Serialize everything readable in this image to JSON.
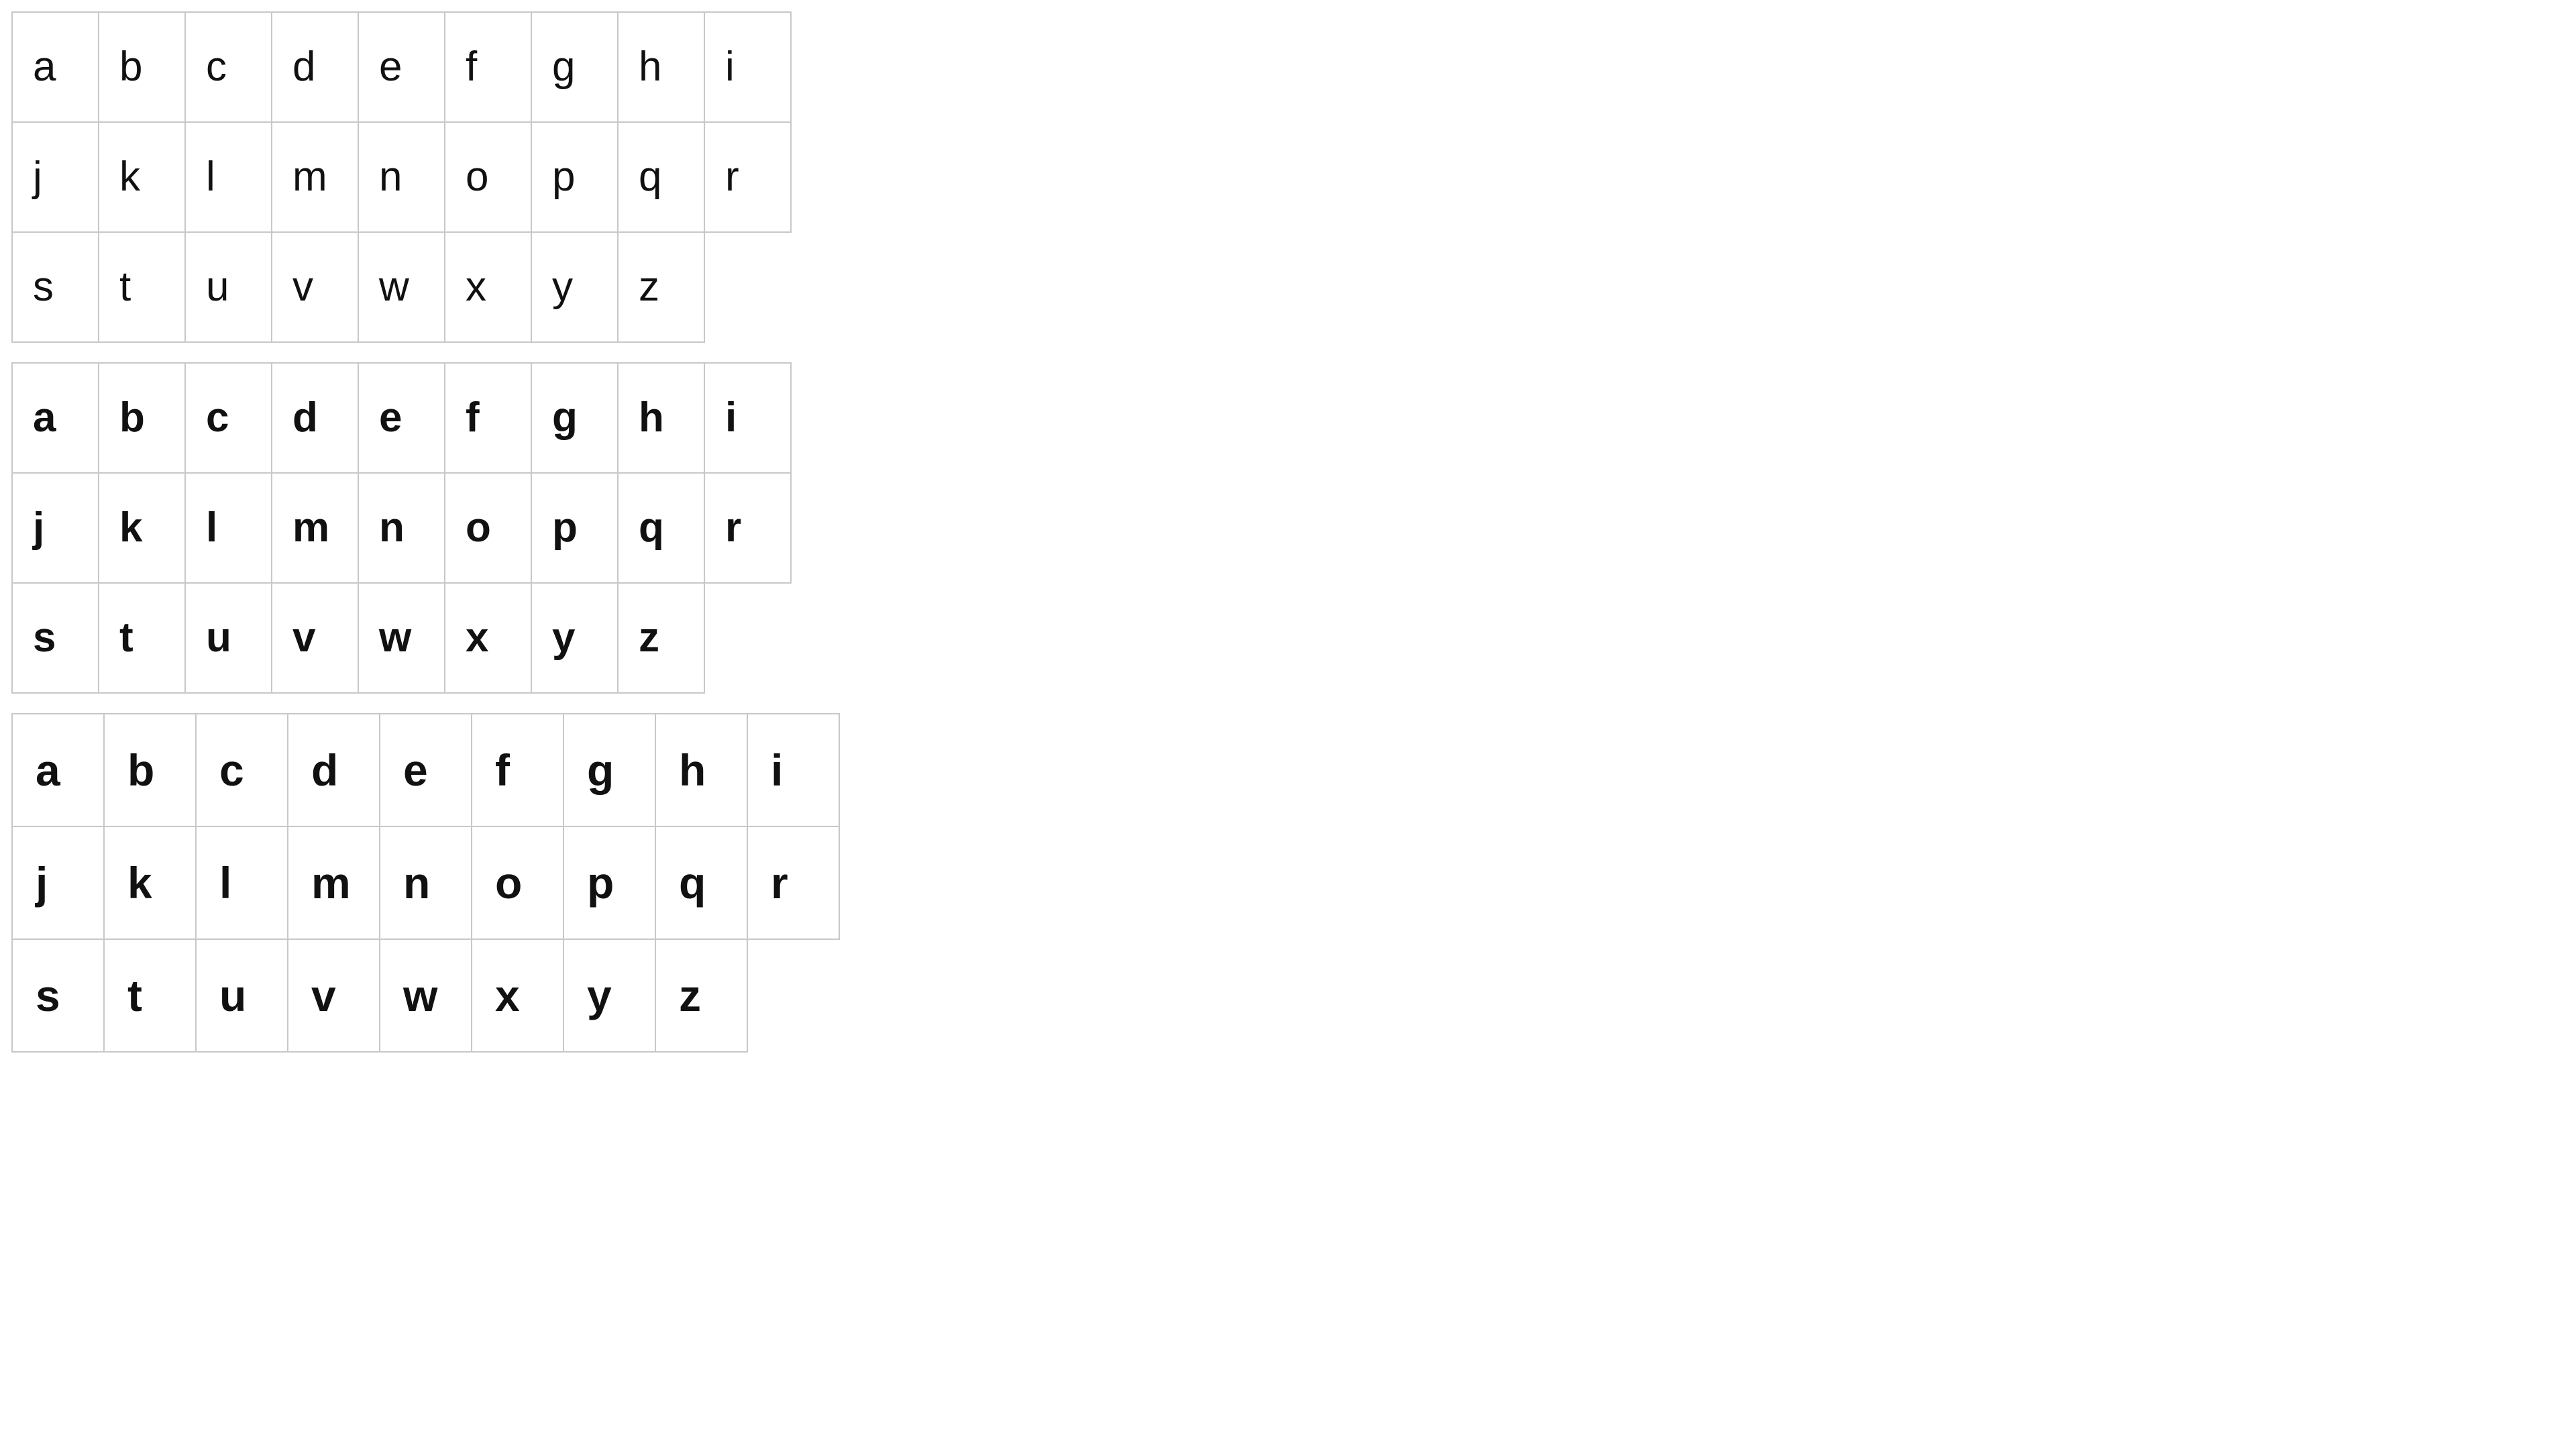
{
  "letter_grids": [
    {
      "weight": "regular",
      "rows": [
        [
          "a",
          "b",
          "c",
          "d",
          "e",
          "f",
          "g",
          "h",
          "i"
        ],
        [
          "j",
          "k",
          "l",
          "m",
          "n",
          "o",
          "p",
          "q",
          "r"
        ],
        [
          "s",
          "t",
          "u",
          "v",
          "w",
          "x",
          "y",
          "z"
        ]
      ]
    },
    {
      "weight": "semibold",
      "rows": [
        [
          "a",
          "b",
          "c",
          "d",
          "e",
          "f",
          "g",
          "h",
          "i"
        ],
        [
          "j",
          "k",
          "l",
          "m",
          "n",
          "o",
          "p",
          "q",
          "r"
        ],
        [
          "s",
          "t",
          "u",
          "v",
          "w",
          "x",
          "y",
          "z"
        ]
      ]
    },
    {
      "weight": "bold",
      "rows": [
        [
          "a",
          "b",
          "c",
          "d",
          "e",
          "f",
          "g",
          "h",
          "i"
        ],
        [
          "j",
          "k",
          "l",
          "m",
          "n",
          "o",
          "p",
          "q",
          "r"
        ],
        [
          "s",
          "t",
          "u",
          "v",
          "w",
          "x",
          "y",
          "z"
        ]
      ]
    }
  ],
  "colors": {
    "background": "#ffffff",
    "grid_line": "#c8c8c8",
    "text": "#111111"
  }
}
